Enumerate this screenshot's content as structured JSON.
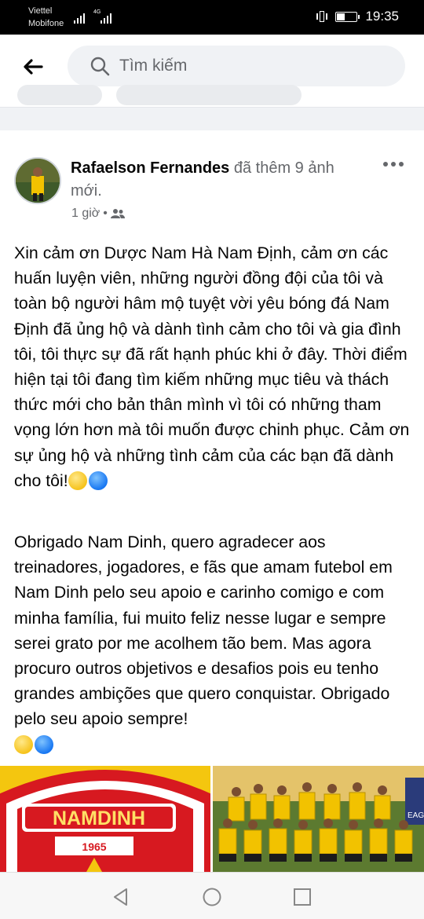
{
  "status_bar": {
    "carrier_1": "Viettel",
    "carrier_2": "Mobifone",
    "network_label": "4G",
    "time": "19:35"
  },
  "search": {
    "placeholder": "Tìm kiếm",
    "icon": "search-icon",
    "back_icon": "arrow-left-icon"
  },
  "post": {
    "author": "Rafaelson Fernandes",
    "action": "đã thêm 9 ảnh mới.",
    "time": "1 giờ",
    "separator": "•",
    "audience_icon": "friends-icon",
    "more_icon": "more-horizontal-icon",
    "text_vi": "Xin cảm ơn Dược Nam Hà Nam Định, cảm ơn các huấn luyện viên, những người đồng đội của tôi và toàn bộ người hâm mộ tuyệt vời yêu bóng đá Nam Định đã ủng hộ và dành tình cảm cho tôi và gia đình tôi, tôi thực sự đã rất hạnh phúc khi ở đây.  Thời điểm hiện tại tôi đang tìm kiếm những mục tiêu và thách thức mới cho bản thân mình vì tôi có những tham vọng lớn hơn mà tôi muốn được chinh phục. Cảm ơn sự ủng hộ và những tình cảm của các bạn đã dành cho tôi!",
    "text_pt": "Obrigado Nam Dinh, quero agradecer aos treinadores, jogadores, e fãs que amam futebol em Nam Dinh pelo seu apoio e carinho comigo e com minha família, fui muito feliz nesse lugar e sempre serei grato por me acolhem tão bem. Mas agora procuro outros objetivos e desafios pois eu tenho grandes ambições que quero conquistar. Obrigado pelo seu apoio sempre!",
    "emoji_colors": [
      "#f6c31c",
      "#1877f2"
    ]
  },
  "photos": {
    "logo_text": "NAMDINH",
    "logo_year": "1965",
    "banner_text": "EAG"
  },
  "colors": {
    "accent": "#1877f2",
    "secondary_text": "#65676b",
    "search_bg": "#f0f2f5",
    "club_yellow": "#f4c60f",
    "club_red": "#d71920"
  },
  "nav": {
    "back_icon": "triangle-back-icon",
    "home_icon": "circle-home-icon",
    "recents_icon": "square-recents-icon"
  }
}
